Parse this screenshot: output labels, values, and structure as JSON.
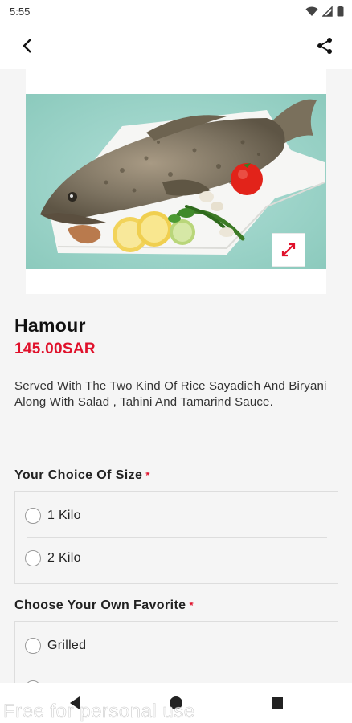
{
  "status_bar": {
    "time": "5:55",
    "icons": [
      "wifi-icon",
      "signal-icon",
      "battery-icon"
    ]
  },
  "app_bar": {
    "back_icon": "back-arrow-icon",
    "share_icon": "share-icon"
  },
  "product": {
    "image_alt": "Hamour fish on plate with lemon, tomato and chili",
    "name": "Hamour",
    "price": "145.00SAR",
    "description": "Served With The Two Kind Of Rice Sayadieh And Biryani Along With Salad , Tahini And Tamarind Sauce."
  },
  "sections": [
    {
      "title": "Your Choice Of Size",
      "required_mark": "*",
      "options": [
        "1 Kilo",
        "2 Kilo"
      ]
    },
    {
      "title": "Choose Your Own Favorite",
      "required_mark": "*",
      "options": [
        "Grilled",
        ""
      ]
    }
  ],
  "nav_bar": {
    "icons": [
      "back-triangle-icon",
      "home-circle-icon",
      "recents-square-icon"
    ]
  },
  "watermark": "Free for personal use",
  "colors": {
    "accent": "#e0112b",
    "image_bg": "#9fd6cc",
    "background": "#f5f5f5"
  }
}
